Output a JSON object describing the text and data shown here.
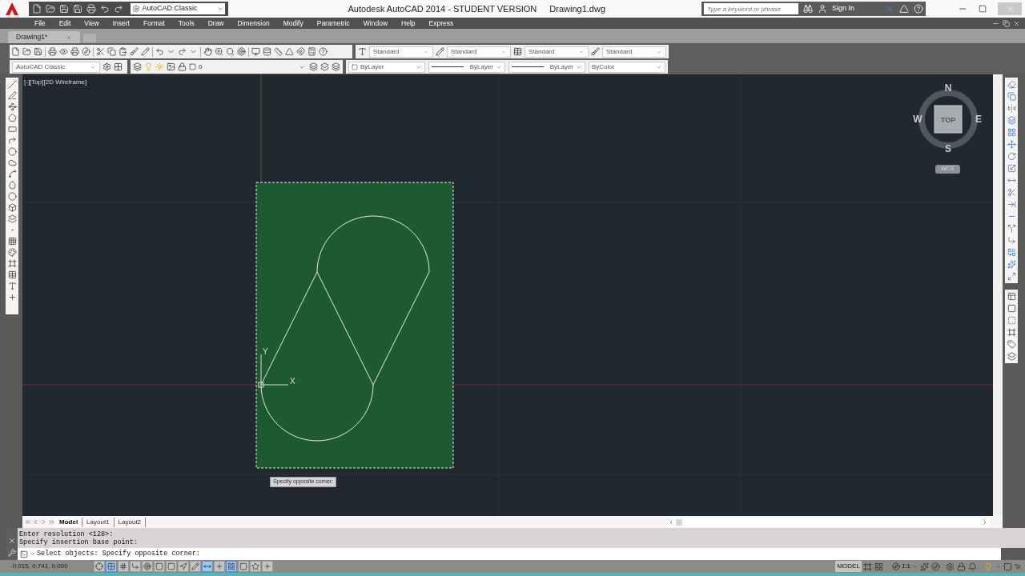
{
  "title_bar": {
    "app": "Autodesk AutoCAD 2014 - STUDENT VERSION",
    "file": "Drawing1.dwg",
    "workspace": "AutoCAD Classic",
    "search_placeholder": "Type a keyword or phrase",
    "sign_in": "Sign In"
  },
  "menu": [
    "File",
    "Edit",
    "View",
    "Insert",
    "Format",
    "Tools",
    "Draw",
    "Dimension",
    "Modify",
    "Parametric",
    "Window",
    "Help",
    "Express"
  ],
  "doc_tabs": [
    {
      "label": "Drawing1*",
      "selected": true
    }
  ],
  "styles": [
    "Standard",
    "Standard",
    "Standard",
    "Standard"
  ],
  "workspace_toolbar": "AutoCAD Classic",
  "layer": "0",
  "properties": [
    "ByLayer",
    "ByLayer",
    "ByLayer",
    "ByColor"
  ],
  "viewport": {
    "label": "[-][Top][2D Wireframe]",
    "tooltip": "Specify opposite corner:",
    "axis_y": "Y",
    "axis_x": "X"
  },
  "viewcube": {
    "face": "TOP",
    "north": "N",
    "south": "S",
    "east": "E",
    "west": "W",
    "ucs": "WCS"
  },
  "layout_tabs": [
    {
      "label": "Model",
      "selected": true
    },
    {
      "label": "Layout1",
      "selected": false
    },
    {
      "label": "Layout2",
      "selected": false
    }
  ],
  "command_history": [
    "Enter resolution <128>:",
    "Specify insertion base point:"
  ],
  "command_line": "Select objects: Specify opposite corner:",
  "status_bar": {
    "coordinates": "-0.015, 0.741, 0.000",
    "space": "MODEL",
    "scale": "1:1",
    "toggles": [
      {
        "on": false
      },
      {
        "on": true
      },
      {
        "on": false
      },
      {
        "on": false
      },
      {
        "on": false
      },
      {
        "on": false
      },
      {
        "on": false
      },
      {
        "on": false
      },
      {
        "on": false
      },
      {
        "on": true
      },
      {
        "on": false
      },
      {
        "on": true
      },
      {
        "on": false
      },
      {
        "on": false
      },
      {
        "on": false
      }
    ]
  }
}
